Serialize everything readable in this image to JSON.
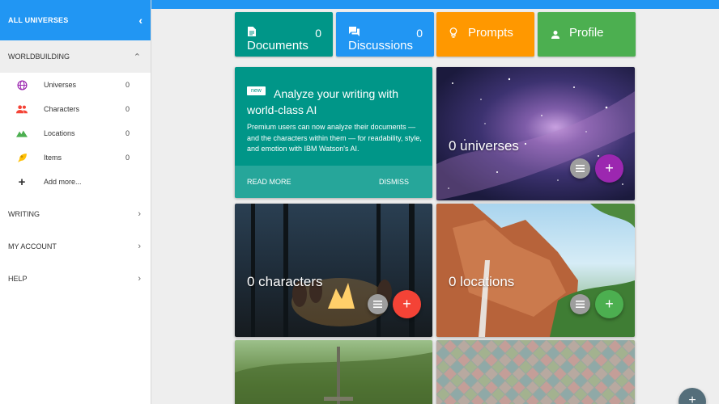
{
  "sidebar": {
    "header": "ALL UNIVERSES",
    "sections": [
      {
        "label": "WORLDBUILDING"
      },
      {
        "label": "WRITING"
      },
      {
        "label": "MY ACCOUNT"
      },
      {
        "label": "HELP"
      }
    ],
    "items": [
      {
        "label": "Universes",
        "count": "0",
        "icon": "globe-icon",
        "color": "#9c27b0"
      },
      {
        "label": "Characters",
        "count": "0",
        "icon": "people-icon",
        "color": "#f44336"
      },
      {
        "label": "Locations",
        "count": "0",
        "icon": "terrain-icon",
        "color": "#4caf50"
      },
      {
        "label": "Items",
        "count": "0",
        "icon": "sword-icon",
        "color": "#ffc107"
      },
      {
        "label": "Add more...",
        "icon": "plus-icon"
      }
    ]
  },
  "tiles": [
    {
      "label": "Documents",
      "count": "0",
      "icon": "document-icon",
      "color": "#009688"
    },
    {
      "label": "Discussions",
      "count": "0",
      "icon": "forum-icon",
      "color": "#2196f3"
    },
    {
      "label": "Prompts",
      "icon": "lightbulb-icon",
      "color": "#ff9800"
    },
    {
      "label": "Profile",
      "icon": "person-icon",
      "color": "#4caf50"
    }
  ],
  "promo": {
    "badge": "new",
    "title": "Analyze your writing with world-class AI",
    "body": "Premium users can now analyze their documents — and the characters within them — for readability, style, and emotion with IBM Watson's AI.",
    "read_more": "READ MORE",
    "dismiss": "DISMISS"
  },
  "cards": {
    "universes": {
      "label": "0 universes",
      "fab_color": "#9c27b0"
    },
    "characters": {
      "label": "0 characters",
      "fab_color": "#f44336"
    },
    "locations": {
      "label": "0 locations",
      "fab_color": "#4caf50"
    }
  },
  "colors": {
    "accent": "#2196f3",
    "corner_fab": "#546e7a"
  }
}
